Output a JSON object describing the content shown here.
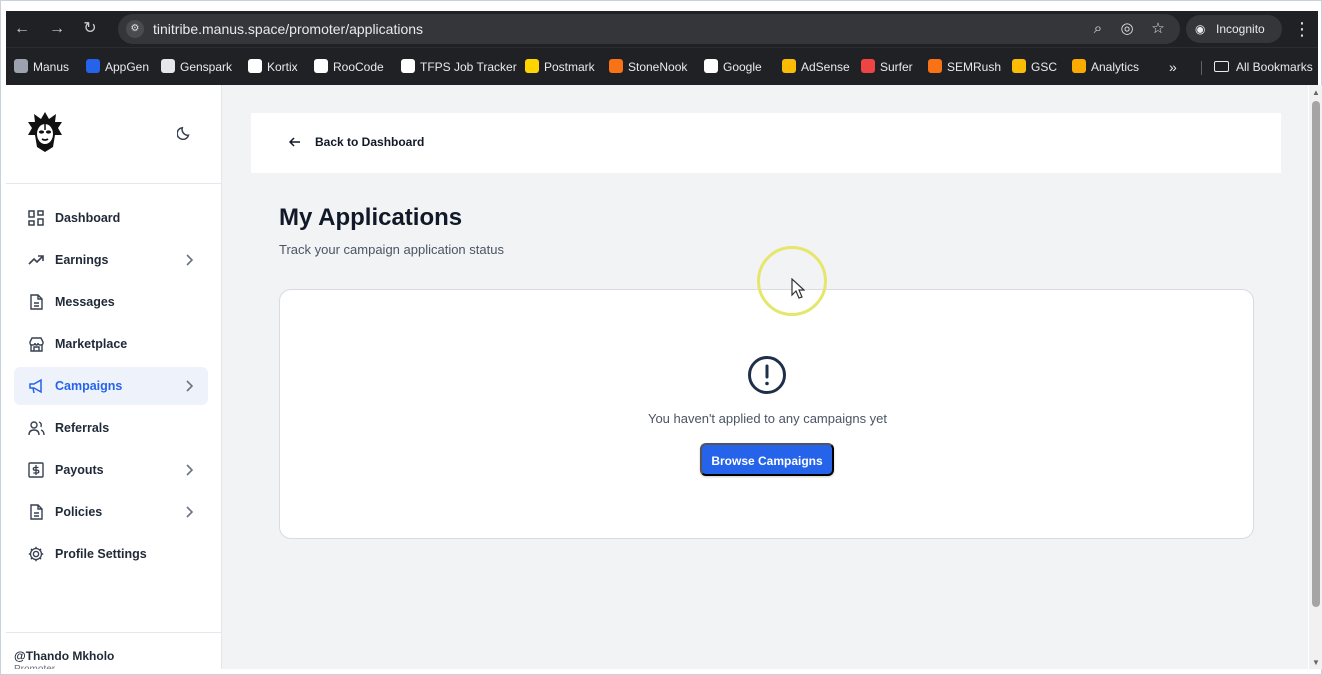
{
  "browser": {
    "url": "tinitribe.manus.space/promoter/applications",
    "incognito_label": "Incognito",
    "bookmarks": [
      {
        "label": "Manus",
        "icon": "manus-icon",
        "color": "#9ca3af"
      },
      {
        "label": "AppGen",
        "icon": "appgen-icon",
        "color": "#2563eb"
      },
      {
        "label": "Genspark",
        "icon": "genspark-icon",
        "color": "#e5e7eb"
      },
      {
        "label": "Kortix",
        "icon": "kortix-icon",
        "color": "#ffffff"
      },
      {
        "label": "RooCode",
        "icon": "roocode-icon",
        "color": "#ffffff"
      },
      {
        "label": "TFPS Job Tracker",
        "icon": "tfps-icon",
        "color": "#ffffff"
      },
      {
        "label": "Postmark",
        "icon": "postmark-icon",
        "color": "#ffd400"
      },
      {
        "label": "StoneNook",
        "icon": "stonenook-icon",
        "color": "#f97316"
      },
      {
        "label": "Google",
        "icon": "google-icon",
        "color": "#ffffff"
      },
      {
        "label": "AdSense",
        "icon": "adsense-icon",
        "color": "#fbbc05"
      },
      {
        "label": "Surfer",
        "icon": "surfer-icon",
        "color": "#ef4444"
      },
      {
        "label": "SEMRush",
        "icon": "semrush-icon",
        "color": "#f97316"
      },
      {
        "label": "GSC",
        "icon": "gsc-icon",
        "color": "#fbbc05"
      },
      {
        "label": "Analytics",
        "icon": "analytics-icon",
        "color": "#f9ab00"
      }
    ],
    "more_bookmarks": "»",
    "all_bookmarks": "All Bookmarks"
  },
  "sidebar": {
    "items": [
      {
        "label": "Dashboard",
        "icon": "dashboard-icon",
        "has_chevron": false
      },
      {
        "label": "Earnings",
        "icon": "trending-up-icon",
        "has_chevron": true
      },
      {
        "label": "Messages",
        "icon": "document-icon",
        "has_chevron": false
      },
      {
        "label": "Marketplace",
        "icon": "store-icon",
        "has_chevron": false
      },
      {
        "label": "Campaigns",
        "icon": "megaphone-icon",
        "has_chevron": true,
        "active": true
      },
      {
        "label": "Referrals",
        "icon": "users-icon",
        "has_chevron": false
      },
      {
        "label": "Payouts",
        "icon": "dollar-icon",
        "has_chevron": true
      },
      {
        "label": "Policies",
        "icon": "policy-icon",
        "has_chevron": true
      },
      {
        "label": "Profile Settings",
        "icon": "gear-icon",
        "has_chevron": false
      }
    ],
    "username": "@Thando Mkholo",
    "role": "Promoter"
  },
  "header": {
    "back_label": "Back to Dashboard"
  },
  "main": {
    "title": "My Applications",
    "subtitle": "Track your campaign application status",
    "empty_message": "You haven't applied to any campaigns yet",
    "browse_button": "Browse Campaigns"
  },
  "colors": {
    "accent": "#2563eb",
    "active_nav_bg": "#eef3fb"
  }
}
